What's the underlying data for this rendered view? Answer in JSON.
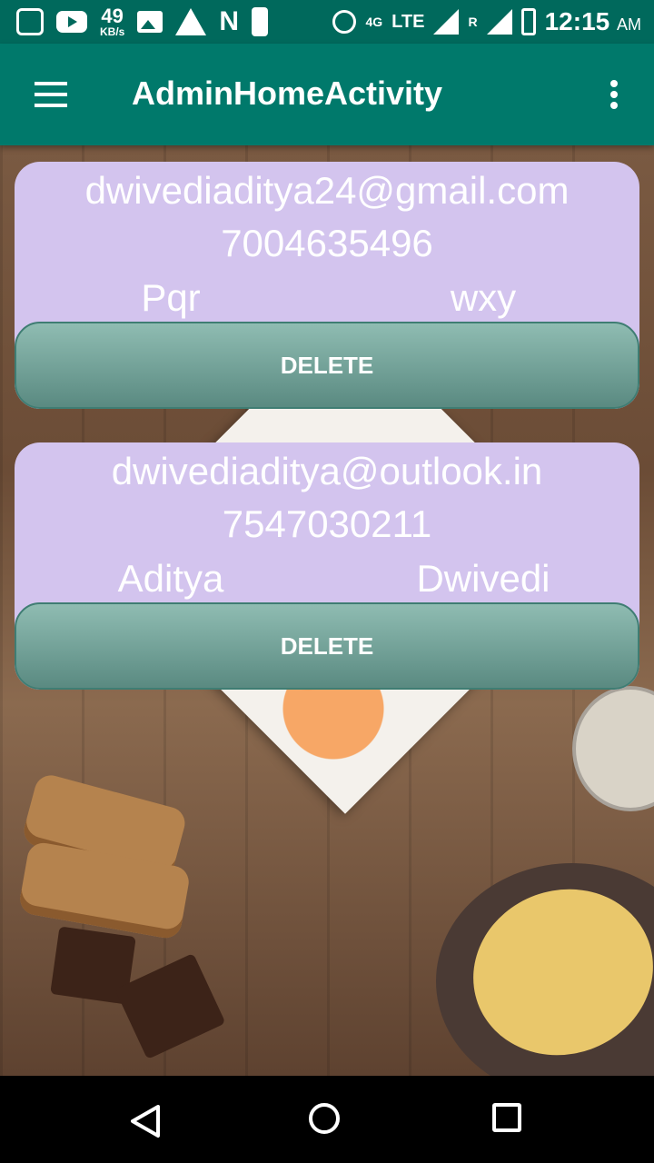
{
  "status_bar": {
    "speed_value": "49",
    "speed_unit": "KB/s",
    "network": "LTE",
    "network_small": "4G",
    "roaming": "R",
    "time": "12:15",
    "ampm": "AM"
  },
  "app_bar": {
    "title": "AdminHomeActivity",
    "menu_icon": "hamburger-menu-icon",
    "overflow_icon": "more-vert-icon",
    "color": "#00796b"
  },
  "users": [
    {
      "email": "dwivediaditya24@gmail.com",
      "phone": "7004635496",
      "first_name": "Pqr",
      "last_name": "wxy",
      "delete_label": "DELETE"
    },
    {
      "email": "dwivediaditya@outlook.in",
      "phone": "7547030211",
      "first_name": "Aditya",
      "last_name": "Dwivedi",
      "delete_label": "DELETE"
    }
  ],
  "colors": {
    "card": "#d3c4ee",
    "button": "#6f9d94",
    "status_bar": "#00695c"
  },
  "nav_bar": {
    "back_icon": "back-triangle-icon",
    "home_icon": "home-circle-icon",
    "recents_icon": "recents-square-icon"
  }
}
